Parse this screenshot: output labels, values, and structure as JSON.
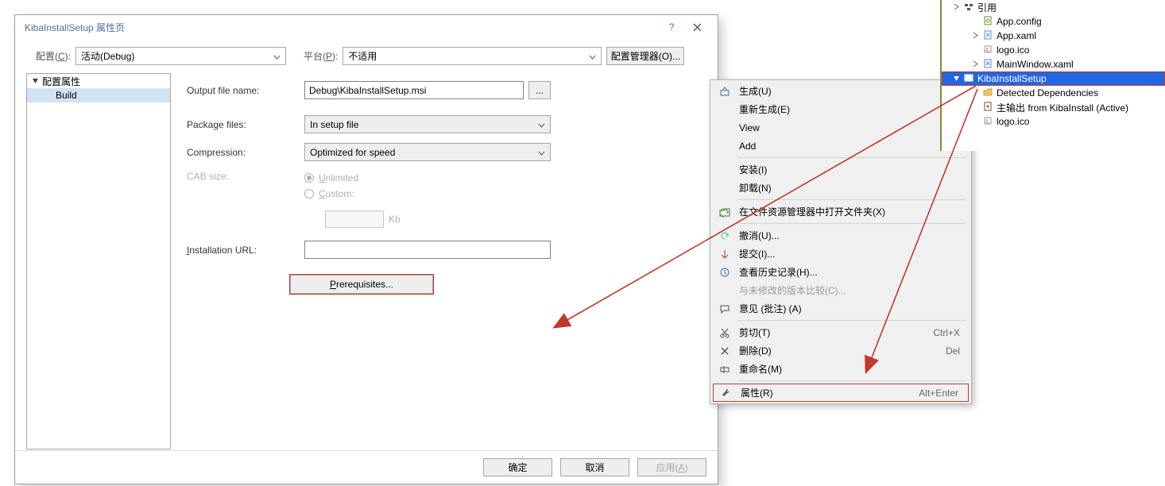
{
  "dialog": {
    "title": "KibaInstallSetup 属性页",
    "help": "?",
    "toolbar": {
      "configLabelPre": "配置(",
      "configLabelUL": "C",
      "configLabelPost": "):",
      "configValue": "活动(Debug)",
      "platformLabelPre": "平台(",
      "platformLabelUL": "P",
      "platformLabelPost": "):",
      "platformValue": "不适用",
      "managerPre": "配置管理器(",
      "managerUL": "O",
      "managerPost": ")..."
    },
    "tree": {
      "root": "配置属性",
      "build": "Build"
    },
    "form": {
      "outputLabel": "Output file name:",
      "outputValue": "Debug\\KibaInstallSetup.msi",
      "browse": "...",
      "packageLabel": "Package files:",
      "packageValue": "In setup file",
      "compressionLabel": "Compression:",
      "compressionValue": "Optimized for speed",
      "cabLabel": "CAB size:",
      "unlimited": "Unlimited",
      "custom": "Custom:",
      "kb": "Kb",
      "urlLabel": "Installation URL:",
      "prereq": "Prerequisites..."
    },
    "footer": {
      "ok": "确定",
      "cancel": "取消",
      "applyPre": "应用(",
      "applyUL": "A",
      "applyPost": ")"
    }
  },
  "contextMenu": {
    "items": [
      {
        "icon": "build-icon",
        "label": "生成(U)",
        "shortcut": "",
        "disabled": false
      },
      {
        "icon": "",
        "label": "重新生成(E)",
        "shortcut": "",
        "disabled": false
      },
      {
        "icon": "",
        "label": "View",
        "shortcut": "",
        "sub": true
      },
      {
        "icon": "",
        "label": "Add",
        "shortcut": "",
        "sub": true
      },
      {
        "sep": true
      },
      {
        "icon": "",
        "label": "安装(I)",
        "shortcut": "",
        "disabled": false
      },
      {
        "icon": "",
        "label": "卸载(N)",
        "shortcut": "",
        "disabled": false
      },
      {
        "sep": true
      },
      {
        "icon": "folder-arrow-icon",
        "label": "在文件资源管理器中打开文件夹(X)",
        "shortcut": "",
        "disabled": false
      },
      {
        "sep": true
      },
      {
        "icon": "undo-icon",
        "label": "撤消(U)...",
        "shortcut": "",
        "disabled": false
      },
      {
        "icon": "commit-icon",
        "label": "提交(I)...",
        "shortcut": "",
        "disabled": false
      },
      {
        "icon": "history-icon",
        "label": "查看历史记录(H)...",
        "shortcut": "",
        "disabled": false
      },
      {
        "icon": "",
        "label": "与未修改的版本比较(C)...",
        "shortcut": "",
        "disabled": true
      },
      {
        "icon": "comment-icon",
        "label": "意见 (批注) (A)",
        "shortcut": "",
        "disabled": false
      },
      {
        "sep": true
      },
      {
        "icon": "cut-icon",
        "label": "剪切(T)",
        "shortcut": "Ctrl+X",
        "disabled": false
      },
      {
        "icon": "delete-icon",
        "label": "删除(D)",
        "shortcut": "Del",
        "disabled": false
      },
      {
        "icon": "rename-icon",
        "label": "重命名(M)",
        "shortcut": "",
        "disabled": false
      },
      {
        "sep": true
      },
      {
        "icon": "wrench-icon",
        "label": "属性(R)",
        "shortcut": "Alt+Enter",
        "disabled": false,
        "highlight": true
      }
    ]
  },
  "solution": {
    "rows": [
      {
        "depth": 0,
        "caret": "right",
        "icon": "ref-icon",
        "label": "引用"
      },
      {
        "depth": 1,
        "caret": "",
        "icon": "cfg-icon",
        "label": "App.config"
      },
      {
        "depth": 1,
        "caret": "right",
        "icon": "xaml-icon",
        "label": "App.xaml"
      },
      {
        "depth": 1,
        "caret": "",
        "icon": "ico-icon",
        "label": "logo.ico"
      },
      {
        "depth": 1,
        "caret": "right",
        "icon": "xaml-icon",
        "label": "MainWindow.xaml"
      },
      {
        "depth": 0,
        "caret": "down",
        "icon": "proj-icon",
        "label": "KibaInstallSetup",
        "selected": true,
        "box": true
      },
      {
        "depth": 1,
        "caret": "",
        "icon": "folder-icon",
        "label": "Detected Dependencies"
      },
      {
        "depth": 1,
        "caret": "",
        "icon": "out-icon",
        "label": "主输出 from KibaInstall (Active)"
      },
      {
        "depth": 1,
        "caret": "",
        "icon": "ico-icon",
        "label": "logo.ico"
      }
    ]
  }
}
